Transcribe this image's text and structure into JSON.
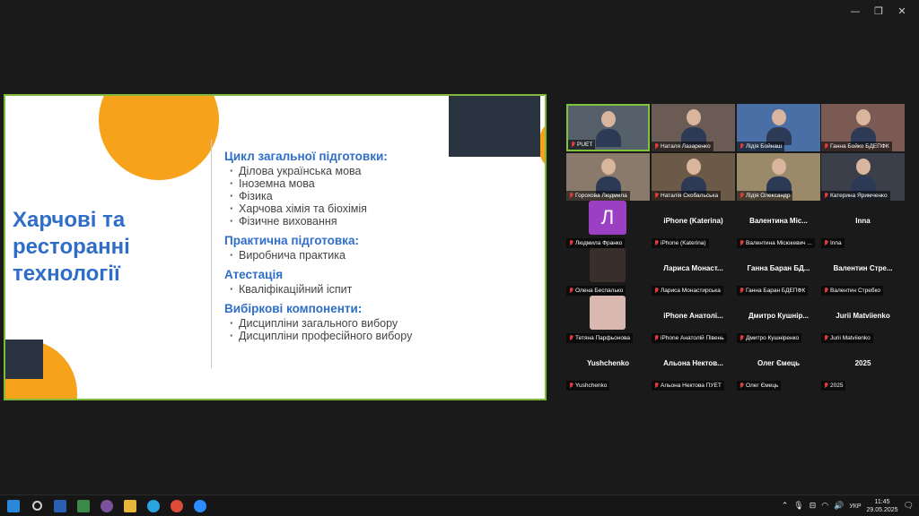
{
  "window": {
    "minimize": "—",
    "maximize": "❐",
    "close": "✕"
  },
  "slide": {
    "title_lines": [
      "Харчові та",
      "ресторанні",
      "технології"
    ],
    "sections": [
      {
        "heading": "Цикл загальної підготовки:",
        "items": [
          "Ділова українська мова",
          "Іноземна мова",
          "Фізика",
          "Харчова хімія та біохімія",
          "Фізичне виховання"
        ]
      },
      {
        "heading": "Практична підготовка:",
        "items": [
          "Виробнича практика"
        ]
      },
      {
        "heading": "Атестація",
        "items": [
          "Кваліфікаційний іспит"
        ]
      },
      {
        "heading": "Вибіркові компоненти:",
        "items": [
          "Дисципліни загального вибору",
          "Дисципліни професійного вибору"
        ]
      }
    ],
    "colors": {
      "accent_blue": "#2f6ec8",
      "orange": "#f7a21b",
      "dark_square": "#2a3440",
      "border_green": "#7fb93a"
    }
  },
  "participants": [
    {
      "tag": "PUET",
      "type": "video",
      "active": true
    },
    {
      "tag": "Наталя Лазаренко",
      "type": "video"
    },
    {
      "tag": "Лідія Бойнаш",
      "type": "video"
    },
    {
      "tag": "Ганна Бойко БДЕПФК",
      "type": "video"
    },
    {
      "tag": "Горохова Людмила",
      "type": "video"
    },
    {
      "tag": "Наталія Скобальська",
      "type": "video"
    },
    {
      "tag": "Лідія Олександр",
      "type": "video"
    },
    {
      "tag": "Катерина Яримченко",
      "type": "video"
    },
    {
      "tag": "Людмила Франко",
      "type": "letter",
      "letter": "Л"
    },
    {
      "tag": "iPhone (Katerina)",
      "type": "name",
      "display": "iPhone (Katerina)"
    },
    {
      "tag": "Валентина Місюкевич ...",
      "type": "name",
      "display": "Валентина Міс..."
    },
    {
      "tag": "Inna",
      "type": "name",
      "display": "Inna"
    },
    {
      "tag": "Олена Беспалько",
      "type": "photo"
    },
    {
      "tag": "Лариса Монастирська",
      "type": "name",
      "display": "Лариса Монаст..."
    },
    {
      "tag": "Ганна Баран БДЕПФК",
      "type": "name",
      "display": "Ганна Баран БД..."
    },
    {
      "tag": "Валентин Стребко",
      "type": "name",
      "display": "Валентин Стре..."
    },
    {
      "tag": "Тетяна Парфьонова",
      "type": "photo"
    },
    {
      "tag": "iPhone Анатолій Півень",
      "type": "name",
      "display": "iPhone Анатолі..."
    },
    {
      "tag": "Дмитро Кушніренко",
      "type": "name",
      "display": "Дмитро Кушнір..."
    },
    {
      "tag": "Jurii Matviienko",
      "type": "name",
      "display": "Jurii Matviienko"
    },
    {
      "tag": "Yushchenko",
      "type": "name",
      "display": "Yushchenko"
    },
    {
      "tag": "Альона Нектова ПУЕТ",
      "type": "name",
      "display": "Альона Нектов..."
    },
    {
      "tag": "Олег Ємець",
      "type": "name",
      "display": "Олег Ємець"
    },
    {
      "tag": "2025",
      "type": "name",
      "display": "2025"
    }
  ],
  "taskbar": {
    "apps": [
      {
        "name": "windows-logo-icon",
        "color": "#2a88d8"
      },
      {
        "name": "search-icon",
        "color": "#cfcfcf"
      },
      {
        "name": "word-icon",
        "color": "#2b5fb4"
      },
      {
        "name": "calendar-icon",
        "color": "#3c8a4a"
      },
      {
        "name": "viber-icon",
        "color": "#7b519d"
      },
      {
        "name": "file-explorer-icon",
        "color": "#e8b73a"
      },
      {
        "name": "telegram-icon",
        "color": "#2aa3de"
      },
      {
        "name": "chrome-icon",
        "color": "#dd4b39"
      },
      {
        "name": "zoom-icon",
        "color": "#2d8cff"
      }
    ],
    "tray": {
      "language": "УКР",
      "time": "11:45",
      "date": "29.05.2025"
    }
  }
}
